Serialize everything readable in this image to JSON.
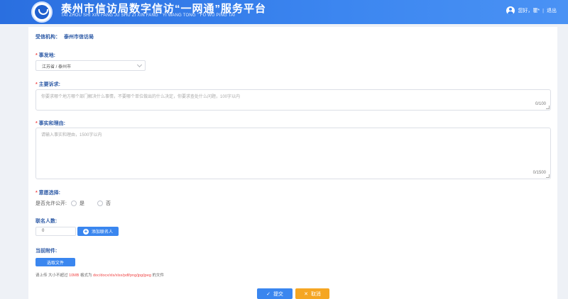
{
  "header": {
    "title": "泰州市信访局数字信访“一网通”服务平台",
    "subtitle": "TAI ZHOU SHI XIN FANG JU SHU ZI XIN FANG \" YI WANG TONG \" FU WU PING TAI",
    "greeting": "您好，",
    "username": "瞿*",
    "separator": "|",
    "logout": "退出"
  },
  "form": {
    "agency_label": "受信机构：",
    "agency_value": "泰州市信访局",
    "location": {
      "label": "事发地:",
      "value": "江苏省 / 泰州市"
    },
    "main_request": {
      "label": "主要诉求:",
      "placeholder": "你要求哪个地方哪个部门解决什么事情，不要哪个单位做出的什么决定，你要求查处什么问题，100字以内",
      "counter": "0/100"
    },
    "facts": {
      "label": "事实和理由:",
      "placeholder": "请输入事实和理由，1500字以内",
      "counter": "0/1500"
    },
    "preference": {
      "label": "意愿选择:",
      "question": "是否允许公开:",
      "options": [
        "是",
        "否"
      ]
    },
    "co_signers": {
      "label": "联名人数:",
      "value": "0",
      "add_button": "添加联名人"
    },
    "attachments": {
      "label": "当前附件:",
      "upload_button": "选取文件",
      "note_prefix": "请上传 大小不超过 ",
      "note_size": "10MB",
      "note_mid": " 格式为 ",
      "note_formats": "doc/docx/xls/xlsx/pdf/png/jpg/jpeg",
      "note_suffix": " 的文件"
    },
    "submit": "提交",
    "cancel": "取消"
  },
  "colors": {
    "header_blue": "#3c86f0",
    "primary": "#3a86ef",
    "warning": "#f5a623",
    "required": "#f04848"
  },
  "icons": {
    "logo": "seal-logo",
    "user": "user-avatar-icon",
    "submit": "check-icon",
    "cancel": "close-icon",
    "add": "plus-circle-icon",
    "dropdown": "chevron-down-icon"
  }
}
